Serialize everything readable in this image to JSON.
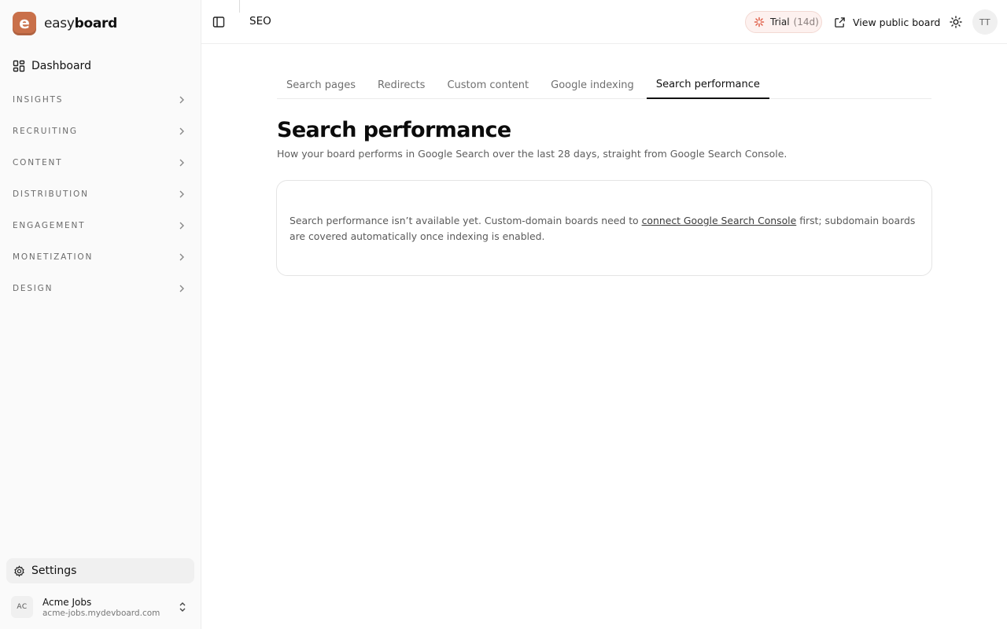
{
  "brand": {
    "logo_letter": "e",
    "name_light": "easy",
    "name_bold": "board"
  },
  "sidebar": {
    "dashboard": "Dashboard",
    "sections": [
      "INSIGHTS",
      "RECRUITING",
      "CONTENT",
      "DISTRIBUTION",
      "ENGAGEMENT",
      "MONETIZATION",
      "DESIGN"
    ],
    "settings": "Settings",
    "account": {
      "initials": "AC",
      "name": "Acme Jobs",
      "domain": "acme-jobs.mydevboard.com"
    }
  },
  "header": {
    "title": "SEO",
    "trial_label": "Trial",
    "trial_days": "(14d)",
    "view_public": "View public board",
    "user_initials": "TT"
  },
  "tabs": [
    {
      "label": "Search pages",
      "active": false
    },
    {
      "label": "Redirects",
      "active": false
    },
    {
      "label": "Custom content",
      "active": false
    },
    {
      "label": "Google indexing",
      "active": false
    },
    {
      "label": "Search performance",
      "active": true
    }
  ],
  "main": {
    "title": "Search performance",
    "subtitle": "How your board performs in Google Search over the last 28 days, straight from Google Search Console.",
    "notice_before": "Search performance isn’t available yet. Custom-domain boards need to ",
    "notice_link": "connect Google Search Console",
    "notice_after": " first; subdomain boards are covered automatically once indexing is enabled."
  },
  "colors": {
    "brand": "#c9704a",
    "trial_bg": "#fdf1ef",
    "trial_icon": "#e0604a",
    "sidebar_bg": "#fafafa"
  }
}
